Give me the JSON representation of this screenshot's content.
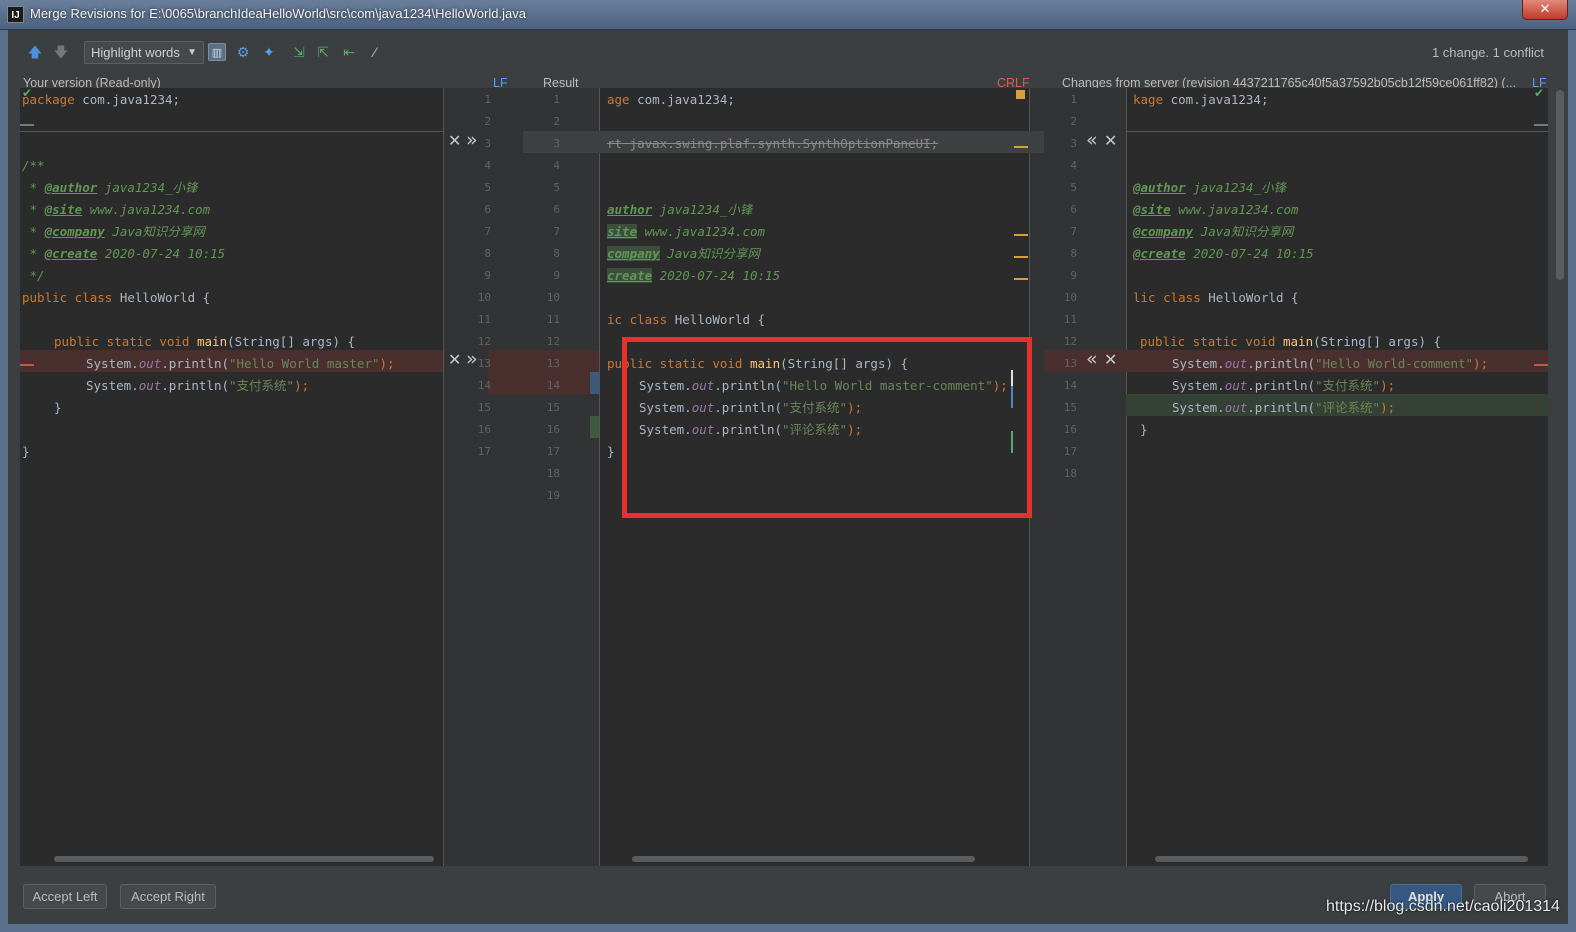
{
  "window": {
    "title": "Merge Revisions for E:\\0065\\branchIdeaHelloWorld\\src\\com\\java1234\\HelloWorld.java",
    "app_icon": "IJ",
    "close_glyph": "✕"
  },
  "toolbar": {
    "highlight_mode": "Highlight words",
    "summary": "1 change. 1 conflict",
    "icons": [
      "arrow-up-icon",
      "arrow-down-icon",
      "side-by-side-icon",
      "gear-icon",
      "magic-resolve-icon",
      "apply-left-icon",
      "apply-right-icon",
      "apply-non-conflicting-icon",
      "wand-icon"
    ]
  },
  "panes": {
    "left": {
      "title": "Your version (Read-only)",
      "line_sep": "LF"
    },
    "middle": {
      "title": "Result",
      "line_sep": "CRLF"
    },
    "right": {
      "title": "Changes from server (revision 4437211765c40f5a37592b05cb12f59ce061ff82) (...",
      "line_sep": "LF"
    }
  },
  "gutter_buttons": {
    "close": "✕",
    "right": "»",
    "left": "«"
  },
  "left_lines": [
    "1",
    "2",
    "3",
    "4",
    "5",
    "6",
    "7",
    "8",
    "9",
    "10",
    "11",
    "12",
    "13",
    "14",
    "15",
    "16",
    "17"
  ],
  "mid_lines": [
    "1",
    "2",
    "3",
    "4",
    "5",
    "6",
    "7",
    "8",
    "9",
    "10",
    "11",
    "12",
    "13",
    "14",
    "15",
    "16",
    "17",
    "18",
    "19"
  ],
  "right_lines": [
    "1",
    "2",
    "3",
    "4",
    "5",
    "6",
    "7",
    "8",
    "9",
    "10",
    "11",
    "12",
    "13",
    "14",
    "15",
    "16",
    "17",
    "18"
  ],
  "code": {
    "l1_kw": "package",
    "l1_rest": " com.java1234;",
    "l4": "/**",
    "author_tag": "@author",
    "author_val": " java1234_小锋",
    "site_tag": "@site",
    "site_val": " www.java1234.com",
    "company_tag": "@company",
    "company_val": " Java知识分享网",
    "create_tag": "@create",
    "create_val": " 2020-07-24 10:15",
    "doc_star": " * ",
    "l9": " */",
    "class_kw": "public class",
    "class_name": " HelloWorld {",
    "main_kw": "public static void",
    "main_name": " main",
    "main_args": "(String[] args) {",
    "sys": "System.",
    "out": "out",
    "println": ".println(",
    "str_master": "\"Hello World master\"",
    "str_pay": "\"支付系统\"",
    "str_comment_sys": "\"评论系统\"",
    "str_server": "\"Hello World-comment\"",
    "str_result": "\"Hello World master-comment\"",
    "close_paren": ");",
    "brace_close": "}",
    "mid_l1_kw": "age",
    "mid_l3": "rt javax.swing.plaf.synth.SynthOptionPaneUI;",
    "mid_author_tag": "author",
    "mid_site_tag": "site",
    "mid_company_tag": "company",
    "mid_create_tag": "create",
    "mid_class_kw": "ic class",
    "mid_main_kw": "public static void",
    "right_l1_kw": "kage",
    "right_class_kw": "lic class"
  },
  "buttons": {
    "accept_left": "Accept Left",
    "accept_right": "Accept Right",
    "apply": "Apply",
    "abort": "Abort"
  },
  "watermark": "https://blog.csdn.net/caoli201314",
  "colors": {
    "annotation_box": "#e8302c",
    "conflict": "#4a2f2f",
    "keyword": "#cc7832",
    "doc": "#629755"
  }
}
